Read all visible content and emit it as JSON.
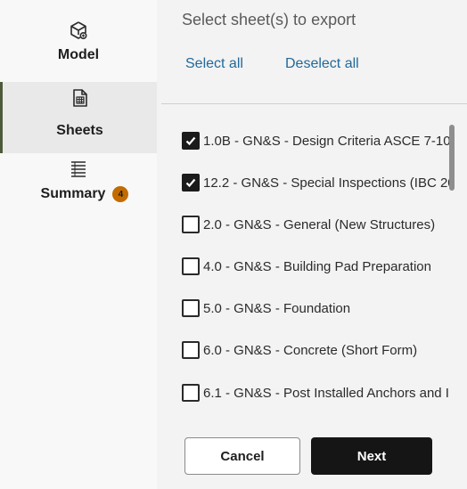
{
  "sidebar": {
    "items": [
      {
        "label": "Model",
        "icon": "model-cube-icon"
      },
      {
        "label": "Sheets",
        "icon": "sheets-document-icon",
        "selected": true
      },
      {
        "label": "Summary",
        "icon": "summary-list-icon",
        "badge": "4"
      }
    ]
  },
  "main": {
    "title": "Select sheet(s) to export",
    "select_all": "Select all",
    "deselect_all": "Deselect all",
    "sheets": [
      {
        "label": "1.0B - GN&S - Design Criteria ASCE 7-10",
        "checked": true
      },
      {
        "label": "12.2 - GN&S - Special Inspections (IBC 20",
        "checked": true
      },
      {
        "label": "2.0 - GN&S - General (New Structures)",
        "checked": false
      },
      {
        "label": "4.0 - GN&S - Building Pad Preparation",
        "checked": false
      },
      {
        "label": "5.0 - GN&S - Foundation",
        "checked": false
      },
      {
        "label": "6.0 - GN&S - Concrete (Short Form)",
        "checked": false
      },
      {
        "label": "6.1 - GN&S - Post Installed Anchors and I",
        "checked": false
      }
    ]
  },
  "footer": {
    "cancel_label": "Cancel",
    "next_label": "Next"
  },
  "colors": {
    "accent_link": "#22699a",
    "badge": "#c26b00",
    "primary_button": "#151515",
    "selected_nav_border": "#4d5a3a"
  }
}
